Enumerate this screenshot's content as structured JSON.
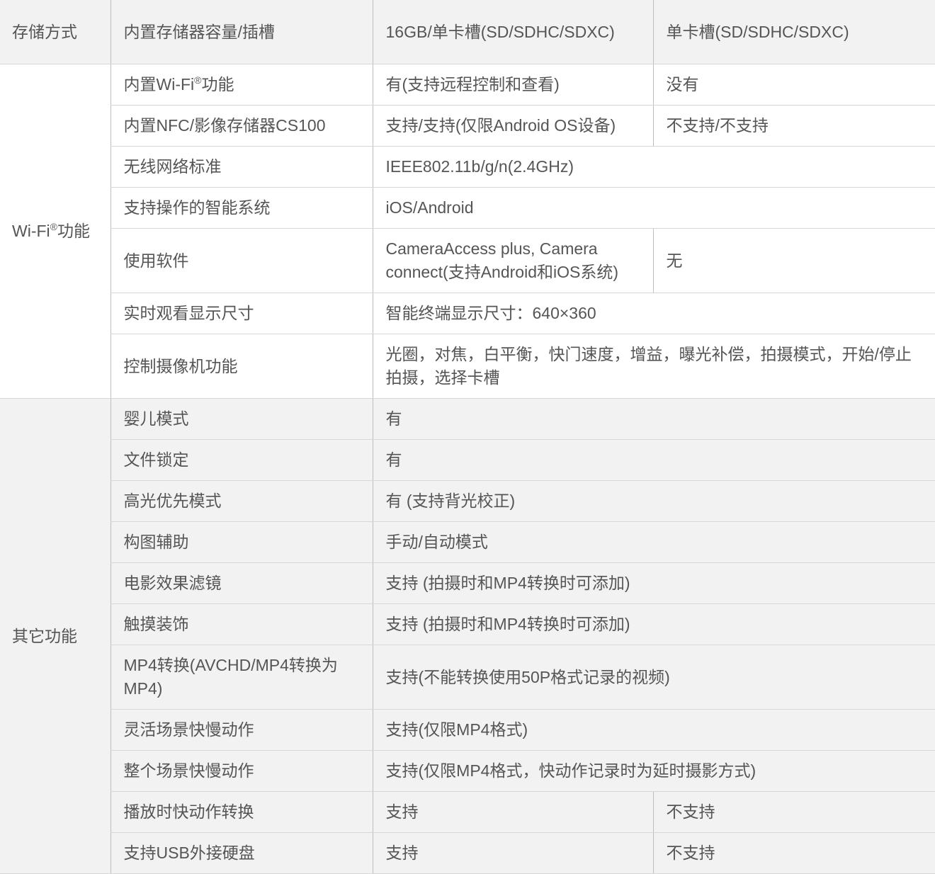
{
  "table": {
    "storage": {
      "category": "存储方式",
      "item": "内置存储器容量/插槽",
      "val_a": "16GB/单卡槽(SD/SDHC/SDXC)",
      "val_b": "单卡槽(SD/SDHC/SDXC)"
    },
    "wifi": {
      "category_text": "Wi-Fi",
      "category_sup": "®",
      "category_suffix": "功能",
      "rows": [
        {
          "item_text": "内置Wi-Fi",
          "item_sup": "®",
          "item_suffix": "功能",
          "val_a": "有(支持远程控制和查看)",
          "val_b": "没有"
        },
        {
          "item": "内置NFC/影像存储器CS100",
          "val_a": "支持/支持(仅限Android OS设备)",
          "val_b": "不支持/不支持"
        },
        {
          "item": "无线网络标准",
          "val": "IEEE802.11b/g/n(2.4GHz)"
        },
        {
          "item": "支持操作的智能系统",
          "val": "iOS/Android"
        },
        {
          "item": "使用软件",
          "val_a": "CameraAccess plus, Camera connect(支持Android和iOS系统)",
          "val_b": "无"
        },
        {
          "item": "实时观看显示尺寸",
          "val": "智能终端显示尺寸：640×360"
        },
        {
          "item": "控制摄像机功能",
          "val": "光圈，对焦，白平衡，快门速度，增益，曝光补偿，拍摄模式，开始/停止拍摄，选择卡槽"
        }
      ]
    },
    "other": {
      "category": "其它功能",
      "rows": [
        {
          "item": "婴儿模式",
          "val": "有"
        },
        {
          "item": "文件锁定",
          "val": "有"
        },
        {
          "item": "高光优先模式",
          "val": "有 (支持背光校正)"
        },
        {
          "item": "构图辅助",
          "val": "手动/自动模式"
        },
        {
          "item": "电影效果滤镜",
          "val": "支持 (拍摄时和MP4转换时可添加)"
        },
        {
          "item": "触摸装饰",
          "val": "支持 (拍摄时和MP4转换时可添加)"
        },
        {
          "item": "MP4转换(AVCHD/MP4转换为MP4)",
          "val": "支持(不能转换使用50P格式记录的视频)"
        },
        {
          "item": "灵活场景快慢动作",
          "val": "支持(仅限MP4格式)"
        },
        {
          "item": "整个场景快慢动作",
          "val": "支持(仅限MP4格式，快动作记录时为延时摄影方式)"
        },
        {
          "item": "播放时快动作转换",
          "val_a": "支持",
          "val_b": "不支持"
        },
        {
          "item": "支持USB外接硬盘",
          "val_a": "支持",
          "val_b": "不支持"
        }
      ]
    }
  },
  "colors": {
    "text": "#555555",
    "row_shade": "#f2f2f2",
    "border": "#d6d6d6"
  }
}
